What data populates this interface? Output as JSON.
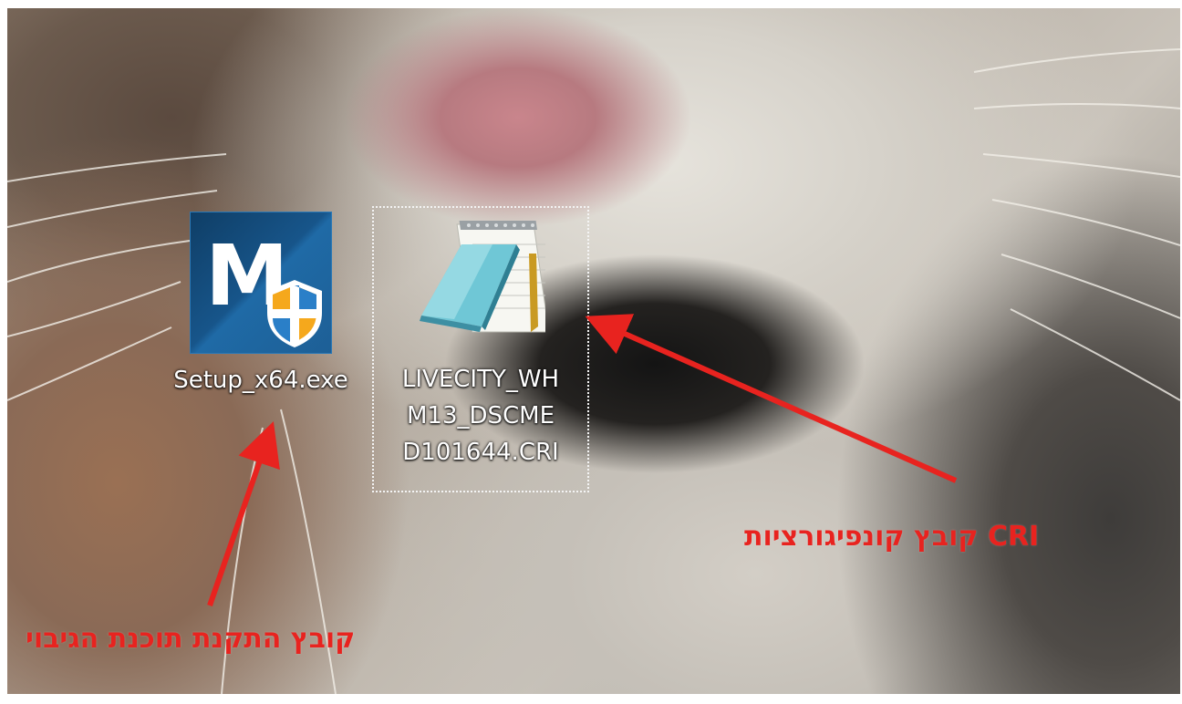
{
  "desktop": {
    "wallpaper": "cat-closeup-photo",
    "icons": [
      {
        "label": "Setup_x64.exe",
        "icon": "m-plus-installer-icon",
        "selected": false
      },
      {
        "label_lines": [
          "LIVECITY_WH",
          "M13_DSCME",
          "D101644.CRI"
        ],
        "icon": "notepad-document-icon",
        "selected": true
      }
    ],
    "logo_letter": "M"
  },
  "annotations": {
    "cri_caption": "CRI קובץ קונפיגורציות",
    "setup_caption": "קובץ התקנת תוכנת הגיבוי",
    "arrow_color": "#e8231f"
  }
}
